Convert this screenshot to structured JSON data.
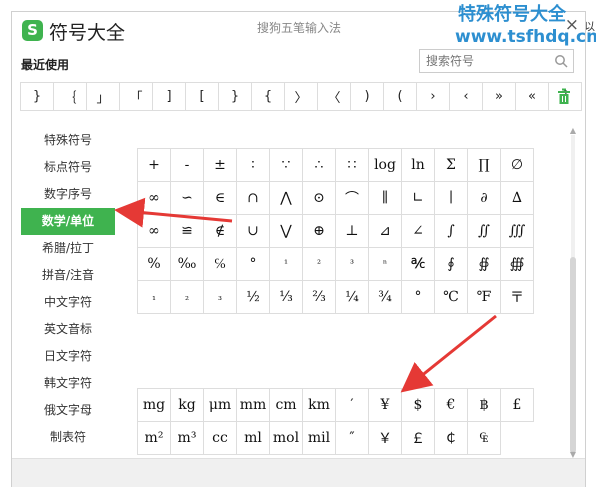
{
  "app_title": "符号大全",
  "logo_glyph": "S",
  "ime_name": "搜狗五笔输入法",
  "close_label": "×",
  "recent_title": "最近使用",
  "search": {
    "placeholder": "搜索符号",
    "icon": "search-icon"
  },
  "recent": [
    "}",
    "｛",
    "」",
    "「",
    "]",
    "[",
    "}",
    "{",
    "〉",
    "〈",
    ")",
    "(",
    "›",
    "‹",
    "»",
    "«",
    "]"
  ],
  "trash_icon": "trash-icon",
  "sidebar": [
    {
      "label": "特殊符号",
      "active": false
    },
    {
      "label": "标点符号",
      "active": false
    },
    {
      "label": "数字序号",
      "active": false
    },
    {
      "label": "数学/单位",
      "active": true
    },
    {
      "label": "希腊/拉丁",
      "active": false
    },
    {
      "label": "拼音/注音",
      "active": false
    },
    {
      "label": "中文字符",
      "active": false
    },
    {
      "label": "英文音标",
      "active": false
    },
    {
      "label": "日文字符",
      "active": false
    },
    {
      "label": "韩文字符",
      "active": false
    },
    {
      "label": "俄文字母",
      "active": false
    },
    {
      "label": "制表符",
      "active": false
    }
  ],
  "math_rows": [
    [
      "+",
      "-",
      "±",
      "∶",
      "∵",
      "∴",
      "∷",
      "log",
      "ln",
      "Σ",
      "∏",
      "∅"
    ],
    [
      "∞",
      "∽",
      "∈",
      "∩",
      "⋀",
      "⊙",
      "⌒",
      "∥",
      "∟",
      "∣",
      "∂",
      "∆"
    ],
    [
      "∞",
      "≌",
      "∉",
      "∪",
      "⋁",
      "⊕",
      "⊥",
      "⊿",
      "∠",
      "∫",
      "∬",
      "∭"
    ],
    [
      "%",
      "‰",
      "℅",
      "°",
      "¹",
      "²",
      "³",
      "ⁿ",
      "℀",
      "∮",
      "∯",
      "∰"
    ],
    [
      "₁",
      "₂",
      "₃",
      "½",
      "⅓",
      "⅔",
      "¼",
      "¾",
      "°",
      "℃",
      "℉",
      "〒"
    ]
  ],
  "unit_rows": [
    [
      "mg",
      "kg",
      "μm",
      "mm",
      "cm",
      "km",
      "′",
      "¥",
      "$",
      "€",
      "฿",
      "£"
    ],
    [
      "m²",
      "m³",
      "cc",
      "ml",
      "mol",
      "mil",
      "″",
      "￥",
      "￡",
      "￠",
      "₠"
    ]
  ],
  "watermark": {
    "line1": "特殊符号大全",
    "line2": "www.tsfhdq.cn"
  },
  "background_fragment": "字\n以\n",
  "annotation_color": "#e53935",
  "accent_color": "#3fb34f",
  "watermark_color": "#2d8fd0"
}
